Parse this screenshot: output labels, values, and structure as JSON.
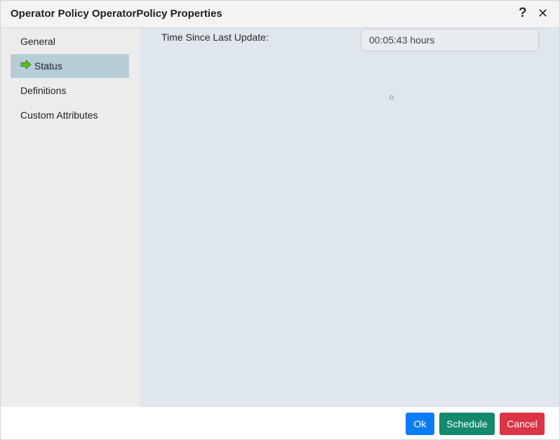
{
  "window": {
    "title": "Operator Policy  OperatorPolicy Properties",
    "help_icon": "?",
    "close_icon": "✕"
  },
  "sidebar": {
    "items": [
      {
        "label": "General",
        "active": false
      },
      {
        "label": "Status",
        "active": true,
        "icon": "green-arrow-right-icon"
      },
      {
        "label": "Definitions",
        "active": false
      },
      {
        "label": "Custom Attributes",
        "active": false
      }
    ]
  },
  "status": {
    "time_since_last_update_label": "Time Since Last Update:",
    "time_since_last_update_value": "00:05:43 hours"
  },
  "footer": {
    "ok_label": "Ok",
    "schedule_label": "Schedule",
    "cancel_label": "Cancel"
  },
  "colors": {
    "active_nav": "#b7cdd6",
    "content_bg": "#e0e6ed",
    "ok": "#0b7cf7",
    "schedule": "#14896b",
    "cancel": "#dc3545",
    "arrow": "#5cb82c"
  }
}
